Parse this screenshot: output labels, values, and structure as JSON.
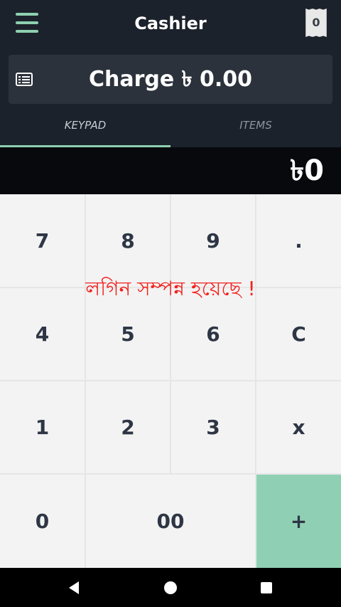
{
  "header": {
    "title": "Cashier",
    "menu_icon": "hamburger-menu-icon",
    "receipt_icon": "receipt-icon",
    "receipt_count": "0"
  },
  "charge": {
    "icon": "list-icon",
    "label": "Charge ৳ 0.00"
  },
  "tabs": [
    {
      "label": "KEYPAD",
      "active": true
    },
    {
      "label": "ITEMS",
      "active": false
    }
  ],
  "display": {
    "value": "৳0"
  },
  "keypad": {
    "keys": [
      "7",
      "8",
      "9",
      ".",
      "4",
      "5",
      "6",
      "C",
      "1",
      "2",
      "3",
      "x",
      "0",
      "00",
      "+"
    ]
  },
  "toast": {
    "message": "লগিন সম্পন্ন হয়েছে !"
  },
  "navbar": {
    "back_icon": "back-triangle-icon",
    "home_icon": "home-circle-icon",
    "recents_icon": "recents-square-icon"
  },
  "colors": {
    "accent": "#8ed0b0",
    "plus_key": "#8fd0b4",
    "toast": "#f2221e",
    "header_bg": "#1c222b",
    "key_bg": "#f3f3f3"
  }
}
